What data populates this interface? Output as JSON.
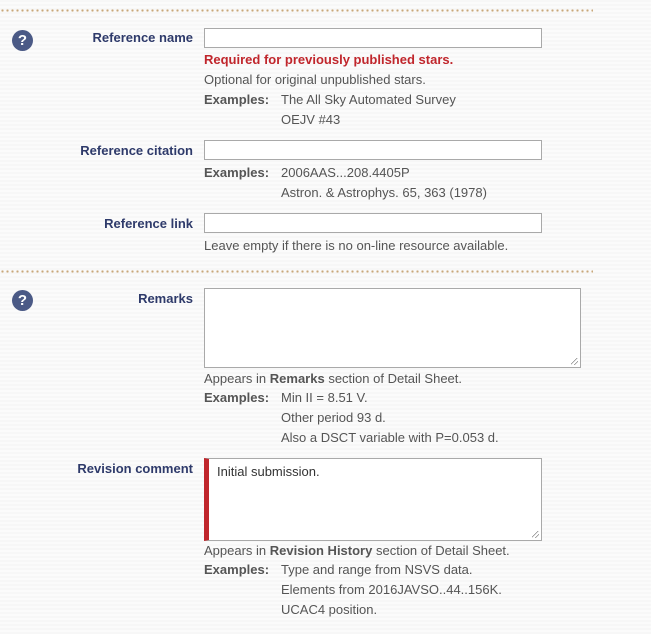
{
  "reference_name": {
    "label": "Reference name",
    "value": "",
    "required_note": "Required for previously published stars.",
    "optional_note": "Optional for original unpublished stars.",
    "examples_label": "Examples:",
    "examples": [
      "The All Sky Automated Survey",
      "OEJV #43"
    ]
  },
  "reference_citation": {
    "label": "Reference citation",
    "value": "",
    "examples_label": "Examples:",
    "examples": [
      "2006AAS...208.4405P",
      "Astron. & Astrophys. 65, 363 (1978)"
    ]
  },
  "reference_link": {
    "label": "Reference link",
    "value": "",
    "note": "Leave empty if there is no on-line resource available."
  },
  "remarks": {
    "label": "Remarks",
    "value": "",
    "note_prefix": "Appears in ",
    "note_bold": "Remarks",
    "note_suffix": " section of Detail Sheet.",
    "examples_label": "Examples:",
    "examples": [
      "Min II = 8.51 V.",
      "Other period 93 d.",
      "Also a DSCT variable with P=0.053 d."
    ]
  },
  "revision_comment": {
    "label": "Revision comment",
    "value": "Initial submission.",
    "note_prefix": "Appears in ",
    "note_bold": "Revision History",
    "note_suffix": " section of Detail Sheet.",
    "examples_label": "Examples:",
    "examples": [
      "Type and range from NSVS data.",
      "Elements from 2016JAVSO..44..156K.",
      "UCAC4 position."
    ]
  },
  "help_icon_glyph": "?",
  "colors": {
    "label": "#2e3a6a",
    "required": "#c0262c",
    "help_icon": "#4b5a86",
    "divider": "#c9a87a"
  }
}
